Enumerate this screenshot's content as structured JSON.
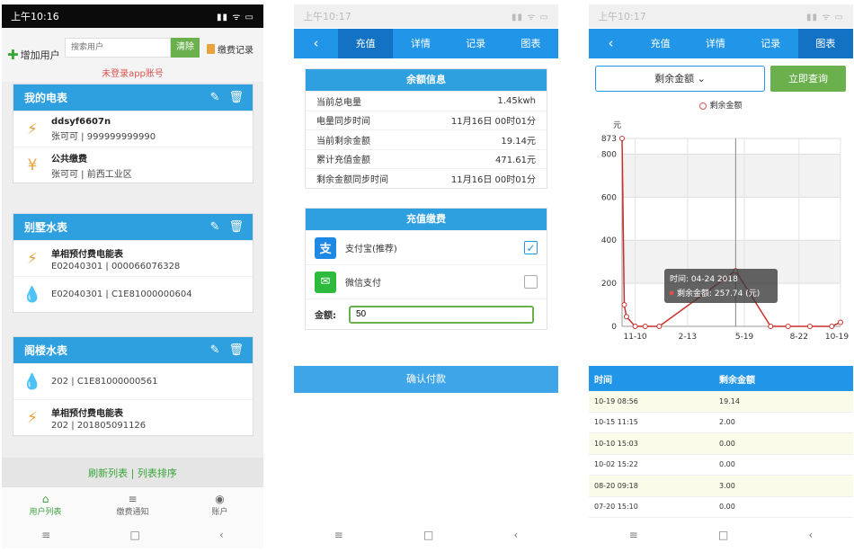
{
  "p1": {
    "status": {
      "time": "上午10:16",
      "icons": "▮▮ ᯤ ▭"
    },
    "add_user": "增加用户",
    "search_placeholder": "搜索用户",
    "clear": "清除",
    "pay_record": "缴费记录",
    "not_logged": "未登录app账号",
    "groups": [
      {
        "title": "我的电表",
        "items": [
          {
            "icon": "bolt",
            "name": "ddsyf6607n",
            "sub": "张可可 | 999999999990"
          },
          {
            "icon": "yen",
            "name": "公共缴费",
            "sub": "张可可 | 前西工业区"
          }
        ]
      },
      {
        "title": "别墅水表",
        "items": [
          {
            "icon": "bolt",
            "name": "单相预付费电能表",
            "sub": "E02040301 | 000066076328"
          },
          {
            "icon": "drop",
            "name": "",
            "sub": "E02040301 | C1E81000000604"
          }
        ]
      },
      {
        "title": "阁楼水表",
        "items": [
          {
            "icon": "drop",
            "name": "",
            "sub": "202 | C1E81000000561"
          },
          {
            "icon": "bolt",
            "name": "单相预付费电能表",
            "sub": "202 | 201805091126"
          }
        ]
      }
    ],
    "refresh": "刷新列表 | 列表排序",
    "tabs": [
      {
        "label": "用户列表",
        "glyph": "⌂"
      },
      {
        "label": "缴费通知",
        "glyph": "≡"
      },
      {
        "label": "账户",
        "glyph": "◉"
      }
    ]
  },
  "p2": {
    "status": {
      "time": "上午10:17",
      "icons": "▮▮ ᯤ ▭"
    },
    "nav": [
      "‹",
      "充值",
      "详情",
      "记录",
      "图表"
    ],
    "balance_title": "余额信息",
    "balance": [
      {
        "k": "当前总电量",
        "v": "1.45kwh"
      },
      {
        "k": "电量同步时间",
        "v": "11月16日 00时01分"
      },
      {
        "k": "当前剩余金额",
        "v": "19.14元"
      },
      {
        "k": "累计充值金额",
        "v": "471.61元"
      },
      {
        "k": "剩余金额同步时间",
        "v": "11月16日 00时01分"
      }
    ],
    "pay_title": "充值缴费",
    "alipay": "支付宝(推荐)",
    "wechat": "微信支付",
    "amount_label": "金额:",
    "amount_value": "50",
    "confirm": "确认付款"
  },
  "p3": {
    "status": {
      "time": "上午10:17",
      "icons": "▮▮ ᯤ ▭"
    },
    "nav": [
      "‹",
      "充值",
      "详情",
      "记录",
      "图表"
    ],
    "dropdown": "剩余金额",
    "query": "立即查询",
    "tooltip_line1": "时间: 04-24 2018",
    "tooltip_line2": "剩余金额: 257.74 (元)",
    "table_head": [
      "时间",
      "剩余金额"
    ],
    "rows": [
      [
        "10-19 08:56",
        "19.14"
      ],
      [
        "10-15 11:15",
        "2.00"
      ],
      [
        "10-10 15:03",
        "0.00"
      ],
      [
        "10-02 15:22",
        "0.00"
      ],
      [
        "08-20 09:18",
        "3.00"
      ],
      [
        "07-20 15:10",
        "0.00"
      ]
    ]
  },
  "chart_data": {
    "type": "line",
    "title": "",
    "legend": "剩余金额",
    "ylabel": "元",
    "ylim": [
      0,
      873
    ],
    "y_ticks": [
      "873",
      "800",
      "600",
      "400",
      "200",
      "0"
    ],
    "x_ticks": [
      "11-10",
      "2-13",
      "5-19",
      "8-22",
      "10-19"
    ],
    "series": [
      {
        "name": "剩余金额",
        "points": [
          [
            0,
            873
          ],
          [
            0.05,
            100
          ],
          [
            0.1,
            45
          ],
          [
            0.3,
            0
          ],
          [
            0.53,
            0
          ],
          [
            0.85,
            0
          ],
          [
            2.6,
            258
          ],
          [
            3.4,
            0
          ],
          [
            3.8,
            0
          ],
          [
            4.3,
            0
          ],
          [
            4.8,
            0
          ],
          [
            5.0,
            19
          ]
        ]
      }
    ]
  }
}
